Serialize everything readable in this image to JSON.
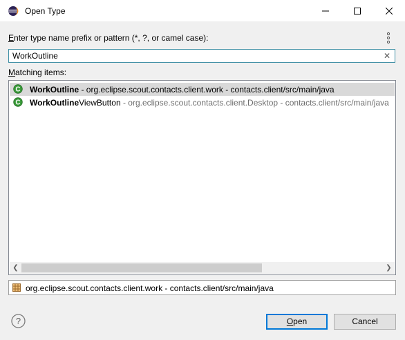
{
  "window": {
    "title": "Open Type",
    "app_icon": "eclipse-icon",
    "controls": [
      "minimize-icon",
      "maximize-icon",
      "close-icon"
    ]
  },
  "search": {
    "label_accel": "E",
    "label_rest": "nter type name prefix or pattern (*, ?, or camel case):",
    "value": "WorkOutline",
    "clear_icon": "clear-icon",
    "menu_icon": "view-menu-icon"
  },
  "matching": {
    "label_accel": "M",
    "label_rest": "atching items:",
    "items": [
      {
        "bold": "WorkOutline",
        "rest": "",
        "detail": " - org.eclipse.scout.contacts.client.work - contacts.client/src/main/java",
        "selected": true,
        "icon": "class-icon"
      },
      {
        "bold": "WorkOutline",
        "rest": "ViewButton",
        "detail": " - org.eclipse.scout.contacts.client.Desktop - contacts.client/src/main/java",
        "selected": false,
        "icon": "class-icon"
      }
    ]
  },
  "details": {
    "icon": "package-icon",
    "text": "org.eclipse.scout.contacts.client.work - contacts.client/src/main/java"
  },
  "buttons": {
    "open_accel": "O",
    "open_rest": "pen",
    "cancel": "Cancel",
    "help_icon": "help-icon"
  },
  "colors": {
    "focus_border": "#3f8fa5",
    "selection": "#d9d9d9",
    "class_icon": "#3a9b3a",
    "default_button_border": "#0078d7"
  }
}
